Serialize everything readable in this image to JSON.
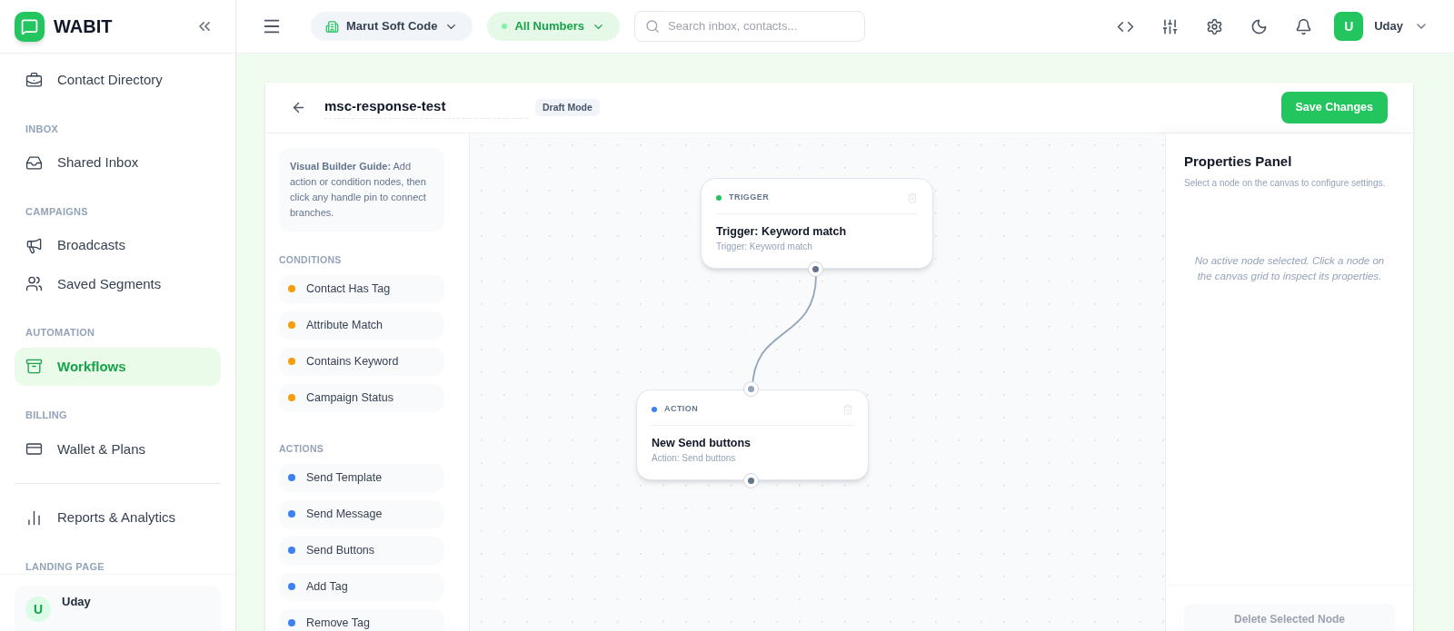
{
  "brand": {
    "name": "WABIT"
  },
  "sidebar": {
    "items": [
      {
        "kind": "item",
        "label": "Contact Directory",
        "selected": false
      },
      {
        "kind": "section",
        "label": "INBOX"
      },
      {
        "kind": "item",
        "label": "Shared Inbox",
        "selected": false
      },
      {
        "kind": "section",
        "label": "CAMPAIGNS"
      },
      {
        "kind": "item",
        "label": "Broadcasts",
        "selected": false
      },
      {
        "kind": "item",
        "label": "Saved Segments",
        "selected": false
      },
      {
        "kind": "section",
        "label": "AUTOMATION"
      },
      {
        "kind": "item",
        "label": "Workflows",
        "selected": true
      },
      {
        "kind": "section",
        "label": "BILLING"
      },
      {
        "kind": "item",
        "label": "Wallet & Plans",
        "selected": false
      },
      {
        "kind": "divider"
      },
      {
        "kind": "item",
        "label": "Reports & Analytics",
        "selected": false
      },
      {
        "kind": "section",
        "label": "LANDING PAGE"
      }
    ],
    "user": {
      "avatar": "U",
      "name": "Uday"
    }
  },
  "topbar": {
    "workspace": "Marut Soft Code",
    "numbers": "All Numbers",
    "search": {
      "placeholder": "Search inbox, contacts..."
    },
    "user": {
      "avatar": "U",
      "name": "Uday"
    }
  },
  "editor": {
    "title": "msc-response-test",
    "badge": "Draft Mode",
    "save": "Save Changes",
    "guide": "**Visual Builder Guide:** Add action or condition nodes, then click any handle pin to connect branches.",
    "groups": [
      {
        "title": "CONDITIONS",
        "items": [
          {
            "label": "Contact Has Tag",
            "color": "#f59e0b"
          },
          {
            "label": "Attribute Match",
            "color": "#f59e0b"
          },
          {
            "label": "Contains Keyword",
            "color": "#f59e0b"
          },
          {
            "label": "Campaign Status",
            "color": "#f59e0b"
          }
        ]
      },
      {
        "title": "ACTIONS",
        "items": [
          {
            "label": "Send Template",
            "color": "#3b82f6"
          },
          {
            "label": "Send Message",
            "color": "#3b82f6"
          },
          {
            "label": "Send Buttons",
            "color": "#3b82f6"
          },
          {
            "label": "Add Tag",
            "color": "#3b82f6"
          },
          {
            "label": "Remove Tag",
            "color": "#3b82f6"
          }
        ]
      }
    ],
    "nodes": [
      {
        "kind": "trigger",
        "type": "TRIGGER",
        "color": "#22c55e",
        "title": "Trigger: Keyword match",
        "subtitle": "Trigger: Keyword match"
      },
      {
        "kind": "action",
        "type": "ACTION",
        "color": "#3b82f6",
        "title": "New Send buttons",
        "subtitle": "Action: Send buttons"
      }
    ],
    "properties": {
      "title": "Properties Panel",
      "subtitle": "Select a node on the canvas to configure settings.",
      "empty": "No active node selected. Click a node on the canvas grid to inspect its properties.",
      "delete": "Delete Selected Node"
    }
  }
}
